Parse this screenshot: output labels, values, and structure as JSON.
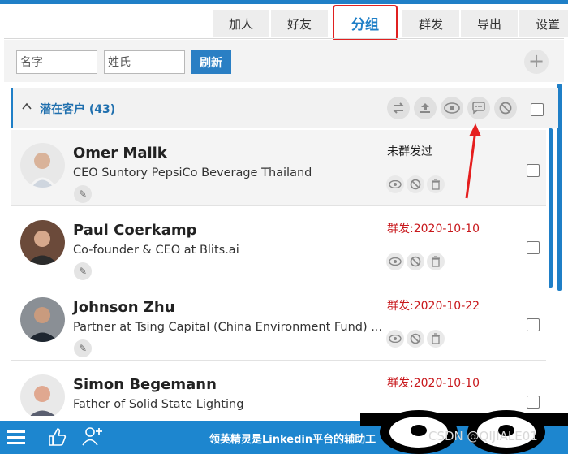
{
  "tabs": [
    {
      "label": "加人"
    },
    {
      "label": "好友"
    },
    {
      "label": "分组",
      "active": true
    },
    {
      "label": "群发"
    },
    {
      "label": "导出"
    },
    {
      "label": "设置"
    }
  ],
  "search": {
    "first_name_placeholder": "名字",
    "last_name_placeholder": "姓氏",
    "refresh_label": "刷新",
    "add_symbol": "+"
  },
  "group": {
    "title": "潜在客户 (43)",
    "collapse_icon": "chevron-up-icon",
    "actions": [
      "swap-icon",
      "upload-icon",
      "eye-icon",
      "comment-icon",
      "block-icon"
    ]
  },
  "contacts": [
    {
      "name": "Omer Malik",
      "title": "CEO Suntory PepsiCo Beverage Thailand",
      "status": "未群发过",
      "sent": false
    },
    {
      "name": "Paul Coerkamp",
      "title": "Co-founder & CEO at Blits.ai",
      "status": "群发:2020-10-10",
      "sent": true
    },
    {
      "name": "Johnson Zhu",
      "title": "Partner at Tsing Capital (China Environment Fund) ...",
      "status": "群发:2020-10-22",
      "sent": true
    },
    {
      "name": "Simon Begemann",
      "title": "Father of Solid State Lighting",
      "status": "群发:2020-10-10",
      "sent": true
    }
  ],
  "bottom": {
    "text": "领英精灵是Linkedin平台的辅助工"
  },
  "watermark": "CSDN @QIJIALE01",
  "colors": {
    "accent": "#1f7fc7",
    "highlight": "#e02020",
    "sent_date": "#c8181c"
  }
}
